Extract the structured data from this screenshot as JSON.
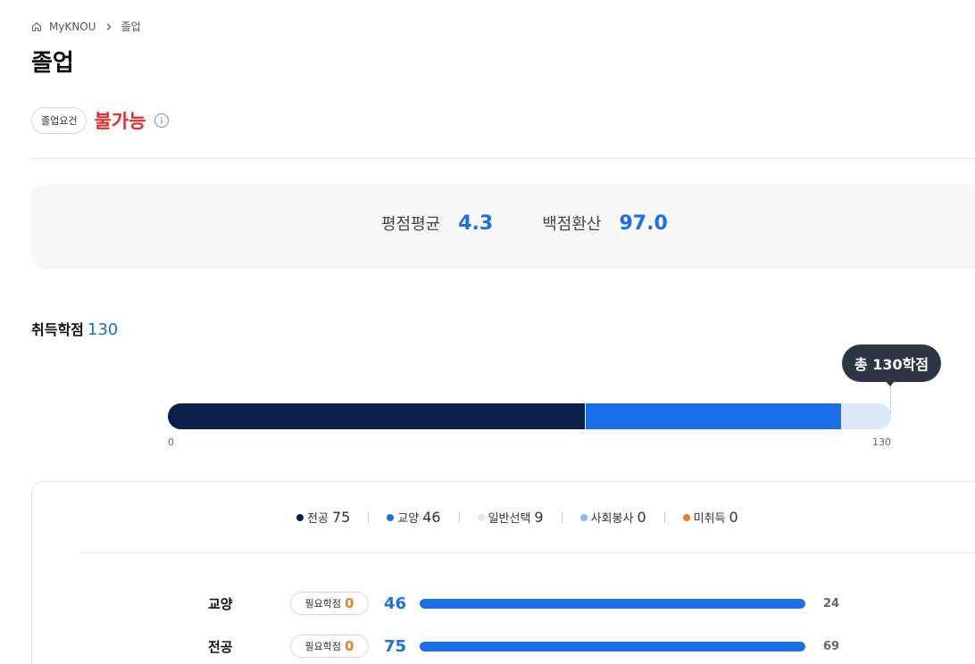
{
  "breadcrumb": {
    "home": "MyKNOU",
    "current": "졸업"
  },
  "page_title": "졸업",
  "requirement": {
    "pill_label": "졸업요건",
    "status": "불가능"
  },
  "gpa": {
    "avg_label": "평점평균",
    "avg_value": "4.3",
    "score_label": "백점환산",
    "score_value": "97.0"
  },
  "credits": {
    "title": "취득학점",
    "total": "130",
    "tooltip": "총 130학점",
    "axis_min": "0",
    "axis_max": "130"
  },
  "legend": [
    {
      "label": "전공",
      "value": "75",
      "color": "#0c1f4a"
    },
    {
      "label": "교양",
      "value": "46",
      "color": "#1a6fe8"
    },
    {
      "label": "일반선택",
      "value": "9",
      "color": "#dbe9fb"
    },
    {
      "label": "사회봉사",
      "value": "0",
      "color": "#8ab8f2"
    },
    {
      "label": "미취득",
      "value": "0",
      "color": "#f07d1a"
    }
  ],
  "rows": [
    {
      "label": "교양",
      "req_label": "필요학점",
      "req_value": "0",
      "earned": "46",
      "fill_percent": 100,
      "remain": "24"
    },
    {
      "label": "전공",
      "req_label": "필요학점",
      "req_value": "0",
      "earned": "75",
      "fill_percent": 100,
      "remain": "69"
    }
  ],
  "colors": {
    "accent": "#1a6fe8",
    "danger": "#e52b2b",
    "warning": "#f07d1a",
    "navy": "#0c1f4a"
  }
}
